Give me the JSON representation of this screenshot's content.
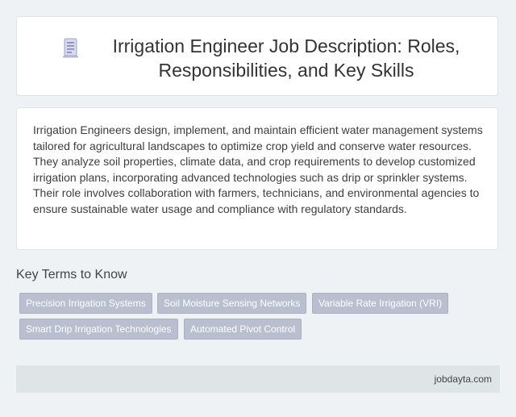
{
  "header": {
    "title": "Irrigation Engineer Job Description: Roles, Responsibilities, and Key Skills",
    "icon": "document-icon"
  },
  "description": "Irrigation Engineers design, implement, and maintain efficient water management systems tailored for agricultural landscapes to optimize crop yield and conserve water resources. They analyze soil properties, climate data, and crop requirements to develop customized irrigation plans, incorporating advanced technologies such as drip or sprinkler systems. Their role involves collaboration with farmers, technicians, and environmental agencies to ensure sustainable water usage and compliance with regulatory standards.",
  "key_terms": {
    "heading": "Key Terms to Know",
    "items": [
      "Precision Irrigation Systems",
      "Soil Moisture Sensing Networks",
      "Variable Rate Irrigation (VRI)",
      "Smart Drip Irrigation Technologies",
      "Automated Pivot Control"
    ]
  },
  "footer": {
    "brand": "jobdayta.com"
  },
  "colors": {
    "background": "#eef2f5",
    "chip": "#b9bfcf",
    "footer": "#dde5e6"
  }
}
